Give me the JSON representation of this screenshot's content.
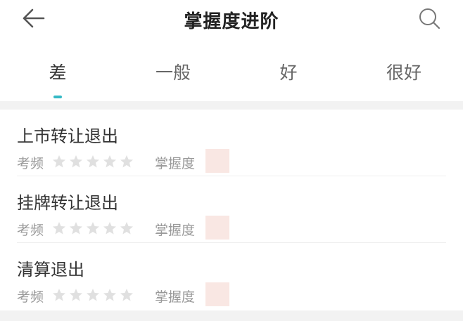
{
  "header": {
    "title": "掌握度进阶"
  },
  "tabs": [
    {
      "label": "差",
      "active": true
    },
    {
      "label": "一般",
      "active": false
    },
    {
      "label": "好",
      "active": false
    },
    {
      "label": "很好",
      "active": false
    }
  ],
  "items": [
    {
      "title": "上市转让退出",
      "freq_label": "考频",
      "freq_stars": 0,
      "mastery_label": "掌握度"
    },
    {
      "title": "挂牌转让退出",
      "freq_label": "考频",
      "freq_stars": 0,
      "mastery_label": "掌握度"
    },
    {
      "title": "清算退出",
      "freq_label": "考频",
      "freq_stars": 0,
      "mastery_label": "掌握度"
    }
  ],
  "colors": {
    "accent": "#35b9c5",
    "star_empty": "#e0e0e0",
    "mastery_fill": "#f9e7e3"
  },
  "icons": {
    "back": "arrow-left-icon",
    "search": "search-icon",
    "star": "star-icon"
  }
}
